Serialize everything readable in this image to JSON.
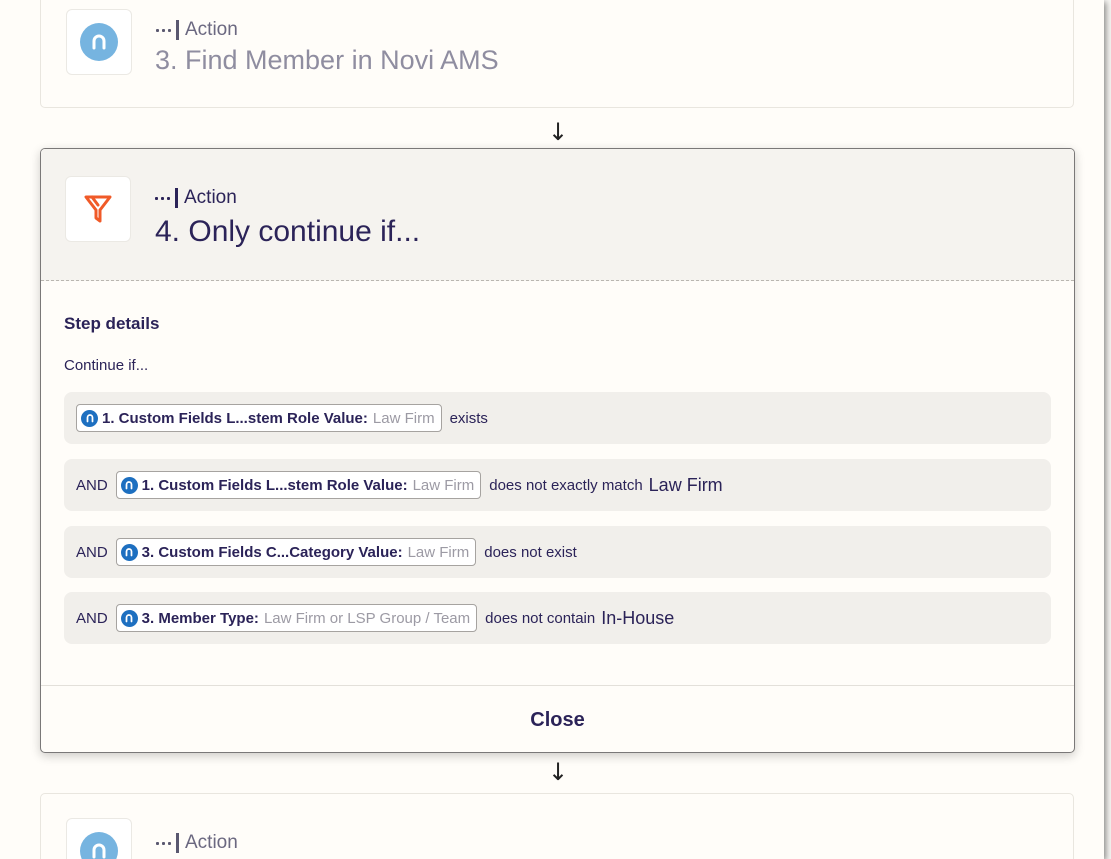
{
  "steps": {
    "prev": {
      "kind": "Action",
      "title": "3. Find Member in Novi AMS"
    },
    "current": {
      "kind": "Action",
      "title": "4. Only continue if..."
    },
    "next": {
      "kind": "Action"
    }
  },
  "details": {
    "section_title": "Step details",
    "continue_label": "Continue if..."
  },
  "conditions": [
    {
      "connector": "",
      "field": "1. Custom Fields L...stem Role Value:",
      "sample": "Law Firm",
      "operator": "exists",
      "value": ""
    },
    {
      "connector": "AND",
      "field": "1. Custom Fields L...stem Role Value:",
      "sample": "Law Firm",
      "operator": "does not exactly match",
      "value": "Law Firm"
    },
    {
      "connector": "AND",
      "field": "3. Custom Fields C...Category Value:",
      "sample": "Law Firm",
      "operator": "does not exist",
      "value": ""
    },
    {
      "connector": "AND",
      "field": "3. Member Type:",
      "sample": "Law Firm or LSP Group / Team",
      "operator": "does not contain",
      "value": "In-House"
    }
  ],
  "footer": {
    "close_label": "Close"
  },
  "colors": {
    "novi_brand": "#76b4e0",
    "novi_pill": "#1d6fc0",
    "filter_orange": "#f05a28",
    "text_dark": "#2b2358"
  },
  "icons": {
    "app": "novi-logo-icon",
    "filter": "filter-icon",
    "step_kind": "action-dots-icon",
    "flow_arrow": "arrow-down-icon"
  }
}
